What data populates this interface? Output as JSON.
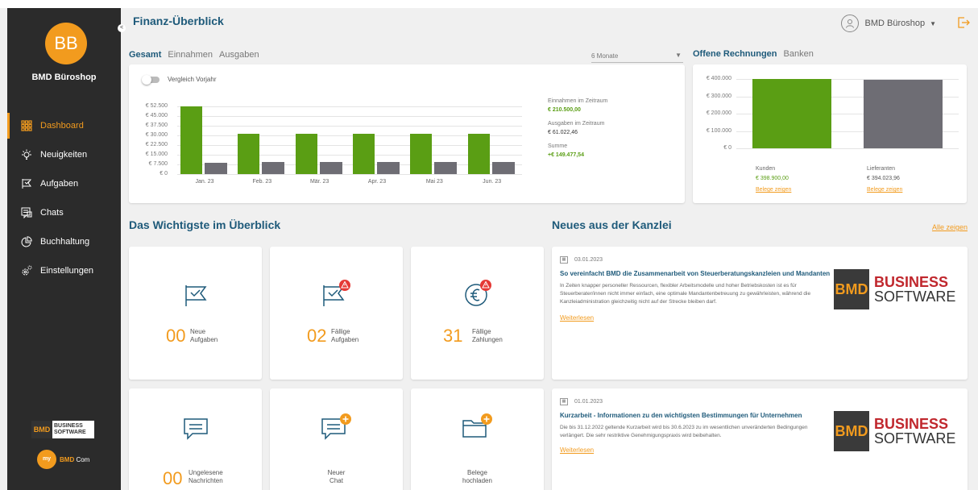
{
  "sidebar": {
    "initials": "BB",
    "company": "BMD Büroshop",
    "items": [
      {
        "label": "Dashboard",
        "icon": "grid-icon"
      },
      {
        "label": "Neuigkeiten",
        "icon": "bulb-icon"
      },
      {
        "label": "Aufgaben",
        "icon": "flag-icon"
      },
      {
        "label": "Chats",
        "icon": "chat-icon"
      },
      {
        "label": "Buchhaltung",
        "icon": "pie-icon"
      },
      {
        "label": "Einstellungen",
        "icon": "gear-icon"
      }
    ],
    "logo": {
      "bmd": "BMD",
      "line1": "BUSINESS",
      "line2": "SOFTWARE"
    },
    "mybmd": {
      "my": "my",
      "bmd": "BMD",
      "com": "Com"
    }
  },
  "header": {
    "title": "Finanz-Überblick",
    "user": "BMD Büroshop",
    "collapse_glyph": "<"
  },
  "finance": {
    "tabs": [
      "Gesamt",
      "Einnahmen",
      "Ausgaben"
    ],
    "period": "6 Monate",
    "toggle_label": "Vergleich Vorjahr",
    "income_label": "Einnahmen im Zeitraum",
    "income_value": "€ 210.500,00",
    "expense_label": "Ausgaben im Zeitraum",
    "expense_value": "€ 61.022,46",
    "sum_label": "Summe",
    "sum_value": "+€ 149.477,54"
  },
  "chart_data": [
    {
      "type": "bar",
      "categories": [
        "Jan. 23",
        "Feb. 23",
        "Mär. 23",
        "Apr. 23",
        "Mai 23",
        "Jun. 23"
      ],
      "series": [
        {
          "name": "Einnahmen",
          "values": [
            53000,
            31500,
            31500,
            31500,
            31500,
            31500
          ],
          "color": "#5a9e14"
        },
        {
          "name": "Ausgaben",
          "values": [
            8500,
            9500,
            9500,
            9500,
            9500,
            9500
          ],
          "color": "#6e6d74"
        }
      ],
      "yticks": [
        "€ 52.500",
        "€ 45.000",
        "€ 37.500",
        "€ 30.000",
        "€ 22.500",
        "€ 15.000",
        "€ 7.500",
        "€ 0"
      ],
      "ylim": [
        0,
        52500
      ],
      "grid": true
    },
    {
      "type": "bar",
      "categories": [
        "Kunden",
        "Lieferanten"
      ],
      "values": [
        398900,
        394023.96
      ],
      "value_labels": [
        "€ 398.900,00",
        "€ 394.023,96"
      ],
      "colors": [
        "#5a9e14",
        "#6e6d74"
      ],
      "yticks": [
        "€ 400.000",
        "€ 300.000",
        "€ 200.000",
        "€ 100.000",
        "€ 0"
      ],
      "ylim": [
        0,
        400000
      ],
      "grid": true
    }
  ],
  "invoices": {
    "tabs": [
      "Offene Rechnungen",
      "Banken"
    ],
    "link_label": "Belege zeigen"
  },
  "overview": {
    "title": "Das Wichtigste im Überblick",
    "tiles": [
      {
        "num": "00",
        "label1": "Neue",
        "label2": "Aufgaben"
      },
      {
        "num": "02",
        "label1": "Fällige",
        "label2": "Aufgaben"
      },
      {
        "num": "31",
        "label1": "Fällige",
        "label2": "Zahlungen"
      },
      {
        "num": "00",
        "label1": "Ungelesene",
        "label2": "Nachrichten"
      },
      {
        "num": "",
        "label1": "Neuer",
        "label2": "Chat"
      },
      {
        "num": "",
        "label1": "Belege",
        "label2": "hochladen"
      }
    ]
  },
  "news": {
    "title": "Neues aus der Kanzlei",
    "all_link": "Alle zeigen",
    "more_label": "Weiterlesen",
    "items": [
      {
        "date": "03.01.2023",
        "title": "So vereinfacht BMD die Zusammenarbeit von Steuerberatungskanzleien und Mandanten",
        "text": "In Zeiten knapper personeller Ressourcen, flexibler Arbeitsmodelle und hoher Betriebskosten ist es für Steuerberater/innen nicht immer einfach, eine optimale Mandantenbetreuung zu gewährleisten, während die Kanzleiadministration gleichzeitig nicht auf der Strecke bleiben darf."
      },
      {
        "date": "01.01.2023",
        "title": "Kurzarbeit - Informationen zu den wichtigsten Bestimmungen für Unternehmen",
        "text": "Die bis 31.12.2022 geltende Kurzarbeit wird bis 30.6.2023 zu im wesentlichen unveränderten Bedingungen verlängert. Die sehr restriktive Genehmigungspraxis wird beibehalten."
      }
    ],
    "logo": {
      "bmd": "BMD",
      "line1": "BUSINESS",
      "line2": "SOFTWARE"
    }
  }
}
